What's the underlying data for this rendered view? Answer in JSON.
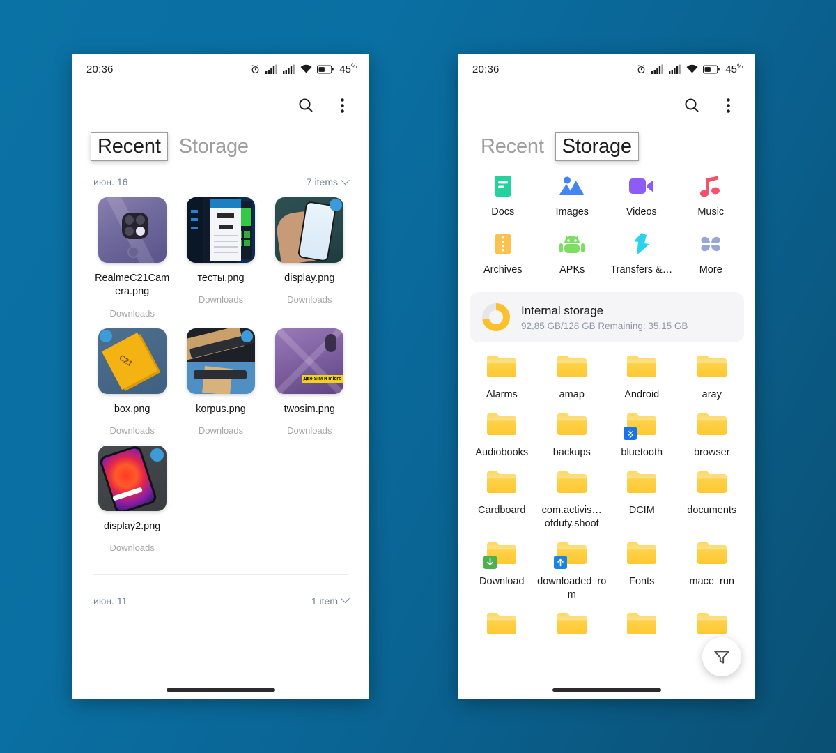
{
  "background_color": "#0b72a5",
  "statusbar": {
    "time": "20:36",
    "battery_percent": "45",
    "percent_symbol": "%",
    "icons": [
      "alarm-icon",
      "signal-sim1-icon",
      "signal-sim2-icon",
      "wifi-icon",
      "battery-icon"
    ]
  },
  "actionbar": {
    "search_label": "search-icon",
    "overflow_label": "more-options-icon"
  },
  "left_phone": {
    "tabs": [
      {
        "label": "Recent",
        "focused": true
      },
      {
        "label": "Storage",
        "focused": false
      }
    ],
    "sections": [
      {
        "date": "июн. 16",
        "count": "7 items"
      },
      {
        "date": "июн. 11",
        "count": "1 item"
      }
    ],
    "files": [
      {
        "name": "RealmeC21Camera.png",
        "location": "Downloads",
        "thumb": "t-realme"
      },
      {
        "name": "тесты.png",
        "location": "Downloads",
        "thumb": "t-tests"
      },
      {
        "name": "display.png",
        "location": "Downloads",
        "thumb": "t-display"
      },
      {
        "name": "box.png",
        "location": "Downloads",
        "thumb": "t-box"
      },
      {
        "name": "korpus.png",
        "location": "Downloads",
        "thumb": "t-korpus"
      },
      {
        "name": "twosim.png",
        "location": "Downloads",
        "thumb": "t-twosim"
      },
      {
        "name": "display2.png",
        "location": "Downloads",
        "thumb": "t-display2"
      }
    ]
  },
  "right_phone": {
    "tabs": [
      {
        "label": "Recent",
        "focused": false
      },
      {
        "label": "Storage",
        "focused": true
      }
    ],
    "categories": [
      {
        "label": "Docs",
        "icon": "docs-icon",
        "color": "#24d2a0"
      },
      {
        "label": "Images",
        "icon": "images-icon",
        "color": "#4285f4"
      },
      {
        "label": "Videos",
        "icon": "videos-icon",
        "color": "#8c5cf5"
      },
      {
        "label": "Music",
        "icon": "music-icon",
        "color": "#f4516c"
      },
      {
        "label": "Archives",
        "icon": "archives-icon",
        "color": "#fcc14f"
      },
      {
        "label": "APKs",
        "icon": "apk-icon",
        "color": "#7ede63"
      },
      {
        "label": "Transfers &…",
        "icon": "transfers-icon",
        "color": "#2ad2ee"
      },
      {
        "label": "More",
        "icon": "more-grid-icon",
        "color": "#9aa6d4"
      }
    ],
    "internal_storage": {
      "title": "Internal storage",
      "subtitle": "92,85 GB/128 GB  Remaining: 35,15 GB",
      "used_gb": 92.85,
      "total_gb": 128,
      "remaining_gb": 35.15,
      "ring_color": "#fbc02d"
    },
    "folders": [
      {
        "label": "Alarms",
        "badge": null
      },
      {
        "label": "amap",
        "badge": null
      },
      {
        "label": "Android",
        "badge": null
      },
      {
        "label": "aray",
        "badge": null
      },
      {
        "label": "Audiobooks",
        "badge": null
      },
      {
        "label": "backups",
        "badge": null
      },
      {
        "label": "bluetooth",
        "badge": "bluetooth-badge-icon"
      },
      {
        "label": "browser",
        "badge": null
      },
      {
        "label": "Cardboard",
        "badge": null
      },
      {
        "label": "com.activis…ofduty.shoot",
        "badge": null
      },
      {
        "label": "DCIM",
        "badge": null
      },
      {
        "label": "documents",
        "badge": null
      },
      {
        "label": "Download",
        "badge": "download-badge-icon"
      },
      {
        "label": "downloaded_rom",
        "badge": "upload-badge-icon"
      },
      {
        "label": "Fonts",
        "badge": null
      },
      {
        "label": "mace_run",
        "badge": null
      },
      {
        "label": "",
        "badge": null
      },
      {
        "label": "",
        "badge": null
      },
      {
        "label": "",
        "badge": null
      },
      {
        "label": "",
        "badge": null
      }
    ],
    "fab": {
      "icon": "filter-icon"
    }
  }
}
